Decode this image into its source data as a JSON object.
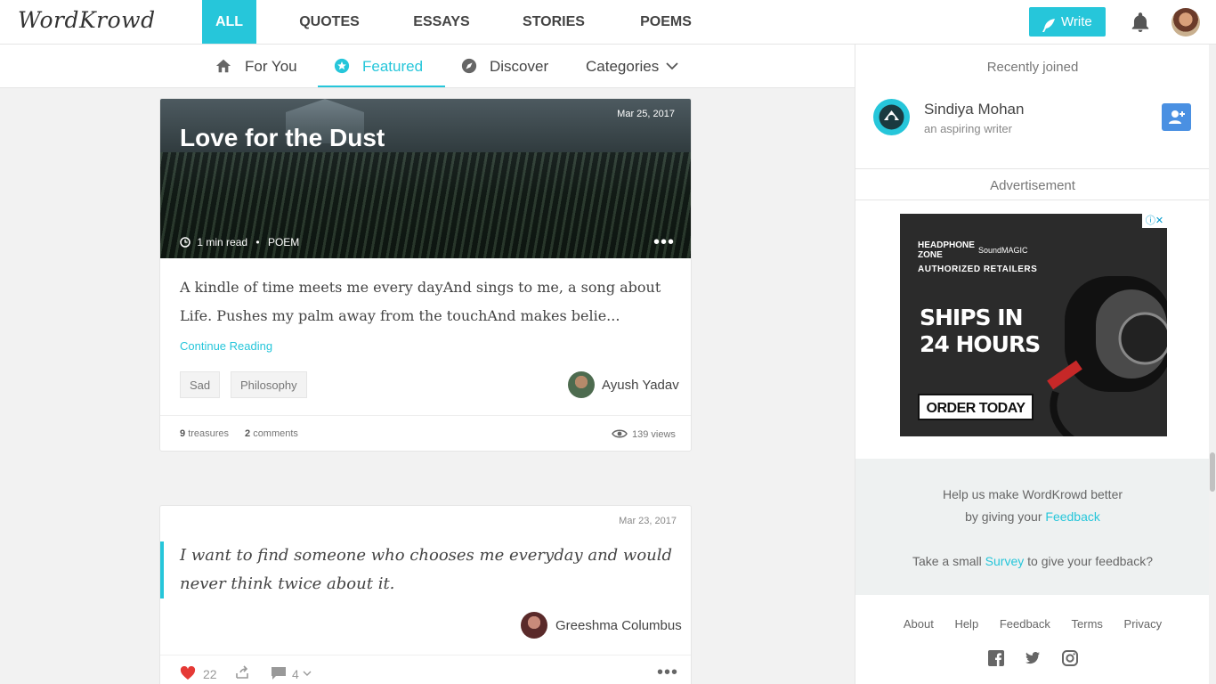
{
  "brand": {
    "logo": "WordKrowd",
    "accent": "#26c6da"
  },
  "categories": [
    {
      "label": "ALL",
      "active": true
    },
    {
      "label": "QUOTES",
      "active": false
    },
    {
      "label": "ESSAYS",
      "active": false
    },
    {
      "label": "STORIES",
      "active": false
    },
    {
      "label": "POEMS",
      "active": false
    }
  ],
  "header": {
    "write_label": "Write",
    "icons": [
      "feather-icon",
      "bell-icon",
      "avatar"
    ]
  },
  "subnav": {
    "tabs": [
      {
        "label": "For You",
        "icon": "home-icon",
        "active": false
      },
      {
        "label": "Featured",
        "icon": "star-icon",
        "active": true
      },
      {
        "label": "Discover",
        "icon": "compass-icon",
        "active": false
      },
      {
        "label": "Categories",
        "icon": "chevron-down-icon",
        "active": false
      }
    ]
  },
  "sidebar": {
    "recently_joined_title": "Recently joined",
    "users": [
      {
        "name": "Sindiya Mohan",
        "subtitle": "an aspiring writer"
      }
    ],
    "ad_title": "Advertisement",
    "ad": {
      "brand1_line1": "HEADPHONE",
      "brand1_line2": "ZONE",
      "brand2": "SoundMAGIC",
      "tagline": "AUTHORIZED RETAILERS",
      "headline1": "SHIPS IN",
      "headline2": "24 HOURS",
      "cta": "ORDER TODAY",
      "close": "ⓘ✕"
    },
    "feedback": {
      "line1": "Help us make WordKrowd better",
      "line2_prefix": "by giving your",
      "line2_link": "Feedback",
      "line3_prefix": "Take a small",
      "line3_link": "Survey",
      "line3_suffix": "to give your feedback?"
    },
    "footer_links": [
      "About",
      "Help",
      "Feedback",
      "Terms",
      "Privacy"
    ],
    "social": [
      "facebook-icon",
      "twitter-icon",
      "instagram-icon"
    ]
  },
  "feed": {
    "poem": {
      "title": "Love for the Dust",
      "date": "Mar 25, 2017",
      "read_time": "1 min read",
      "type": "POEM",
      "excerpt": "A kindle of time meets me every dayAnd sings to me, a song about Life. Pushes my palm away from the touchAnd makes belie...",
      "continue_label": "Continue Reading",
      "tags": [
        "Sad",
        "Philosophy"
      ],
      "author": "Ayush Yadav",
      "treasures_count": "9",
      "treasures_label": "treasures",
      "comments_count": "2",
      "comments_label": "comments",
      "views": "139 views"
    },
    "quote": {
      "date": "Mar 23, 2017",
      "text": "I want to find someone who chooses me everyday and would never think twice about it.",
      "author": "Greeshma Columbus",
      "likes": "22",
      "comments": "4"
    }
  }
}
